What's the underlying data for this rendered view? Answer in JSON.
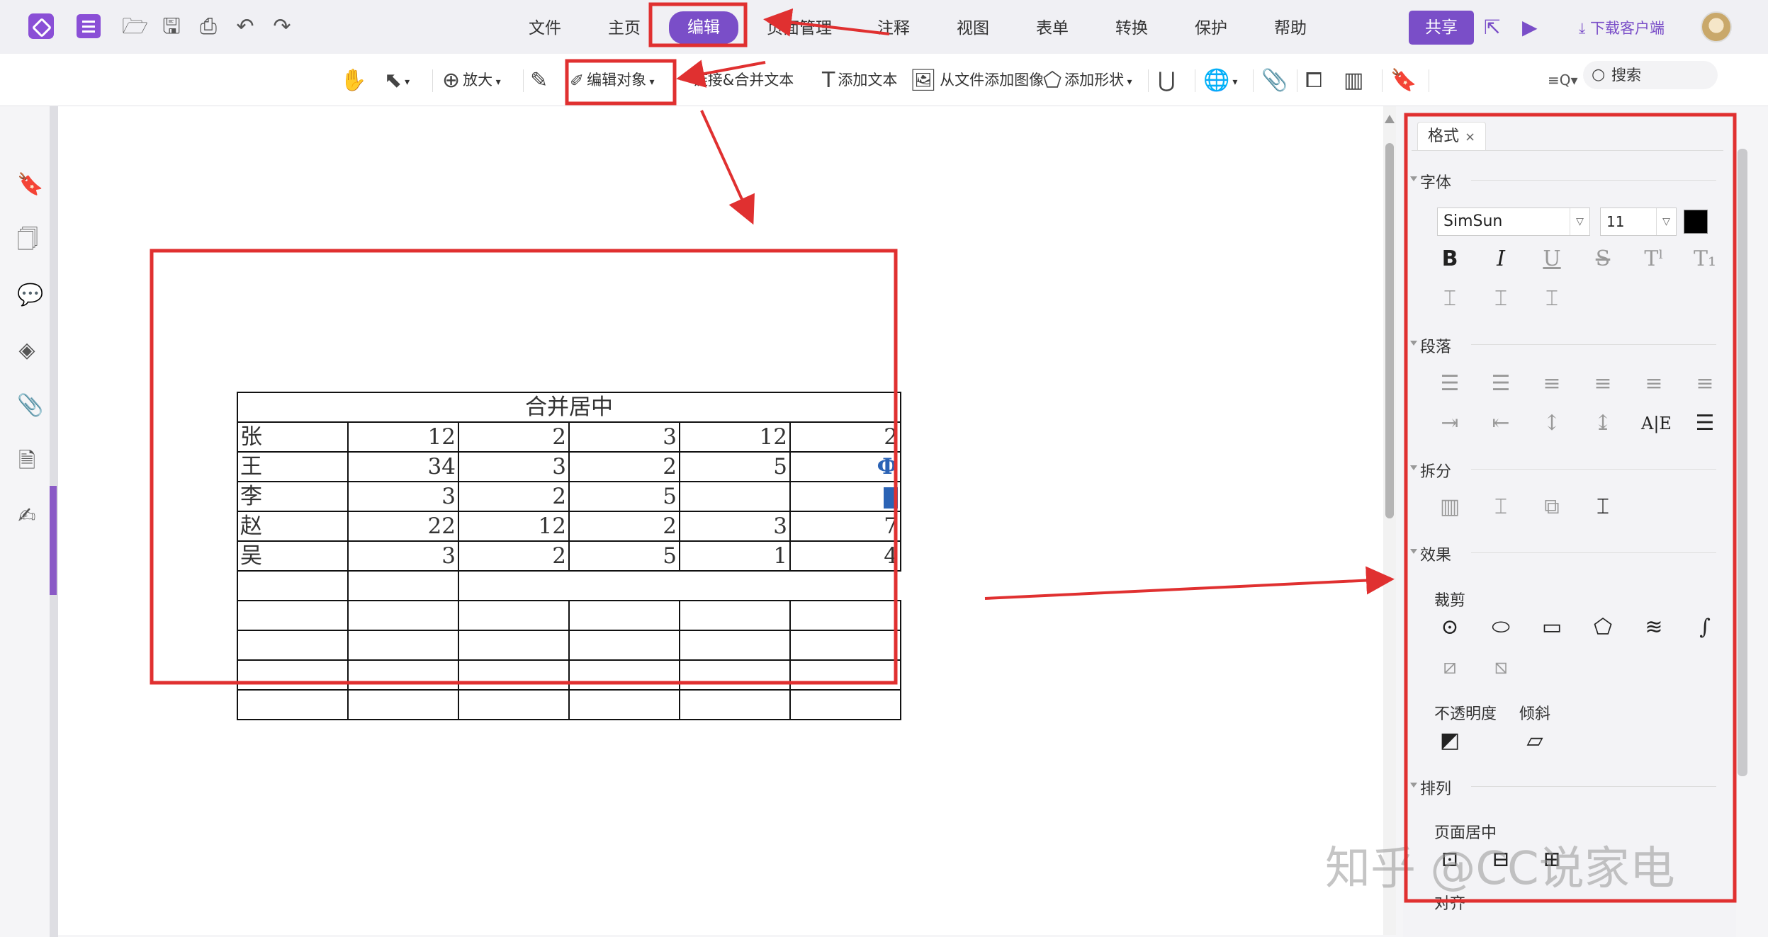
{
  "menubar": {
    "tabs": [
      {
        "label": "文件",
        "active": false
      },
      {
        "label": "主页",
        "active": false
      },
      {
        "label": "编辑",
        "active": true
      },
      {
        "label": "页面管理",
        "active": false
      },
      {
        "label": "注释",
        "active": false
      },
      {
        "label": "视图",
        "active": false
      },
      {
        "label": "表单",
        "active": false
      },
      {
        "label": "转换",
        "active": false
      },
      {
        "label": "保护",
        "active": false
      },
      {
        "label": "帮助",
        "active": false
      }
    ],
    "share_label": "共享",
    "download_label": "下载客户端",
    "accent_color": "#7a4ec8"
  },
  "toolbar": {
    "zoom_label": "放大",
    "edit_object_label": "编辑对象",
    "link_merge_label": "链接&合并文本",
    "add_text_label": "添加文本",
    "add_image_label": "从文件添加图像",
    "add_shape_label": "添加形状",
    "search_label": "搜索"
  },
  "table": {
    "merged_header": "合并居中",
    "rows": [
      [
        "张",
        "12",
        "2",
        "3",
        "12",
        "2"
      ],
      [
        "王",
        "34",
        "3",
        "2",
        "5",
        ""
      ],
      [
        "李",
        "3",
        "2",
        "5",
        "",
        ""
      ],
      [
        "赵",
        "22",
        "12",
        "2",
        "3",
        "7"
      ],
      [
        "吴",
        "3",
        "2",
        "5",
        "1",
        "4"
      ]
    ],
    "empty_rows": 5
  },
  "panel": {
    "tab_label": "格式",
    "close_label": "×",
    "sections": {
      "font": "字体",
      "paragraph": "段落",
      "split": "拆分",
      "effects": "效果",
      "crop": "裁剪",
      "opacity": "不透明度",
      "skew": "倾斜",
      "arrange": "排列",
      "page_center": "页面居中",
      "align": "对齐"
    },
    "font_family": "SimSun",
    "font_size": "11",
    "font_color": "#000000"
  },
  "watermark": "知乎 @CC说家电",
  "annotation_color": "#e03030"
}
